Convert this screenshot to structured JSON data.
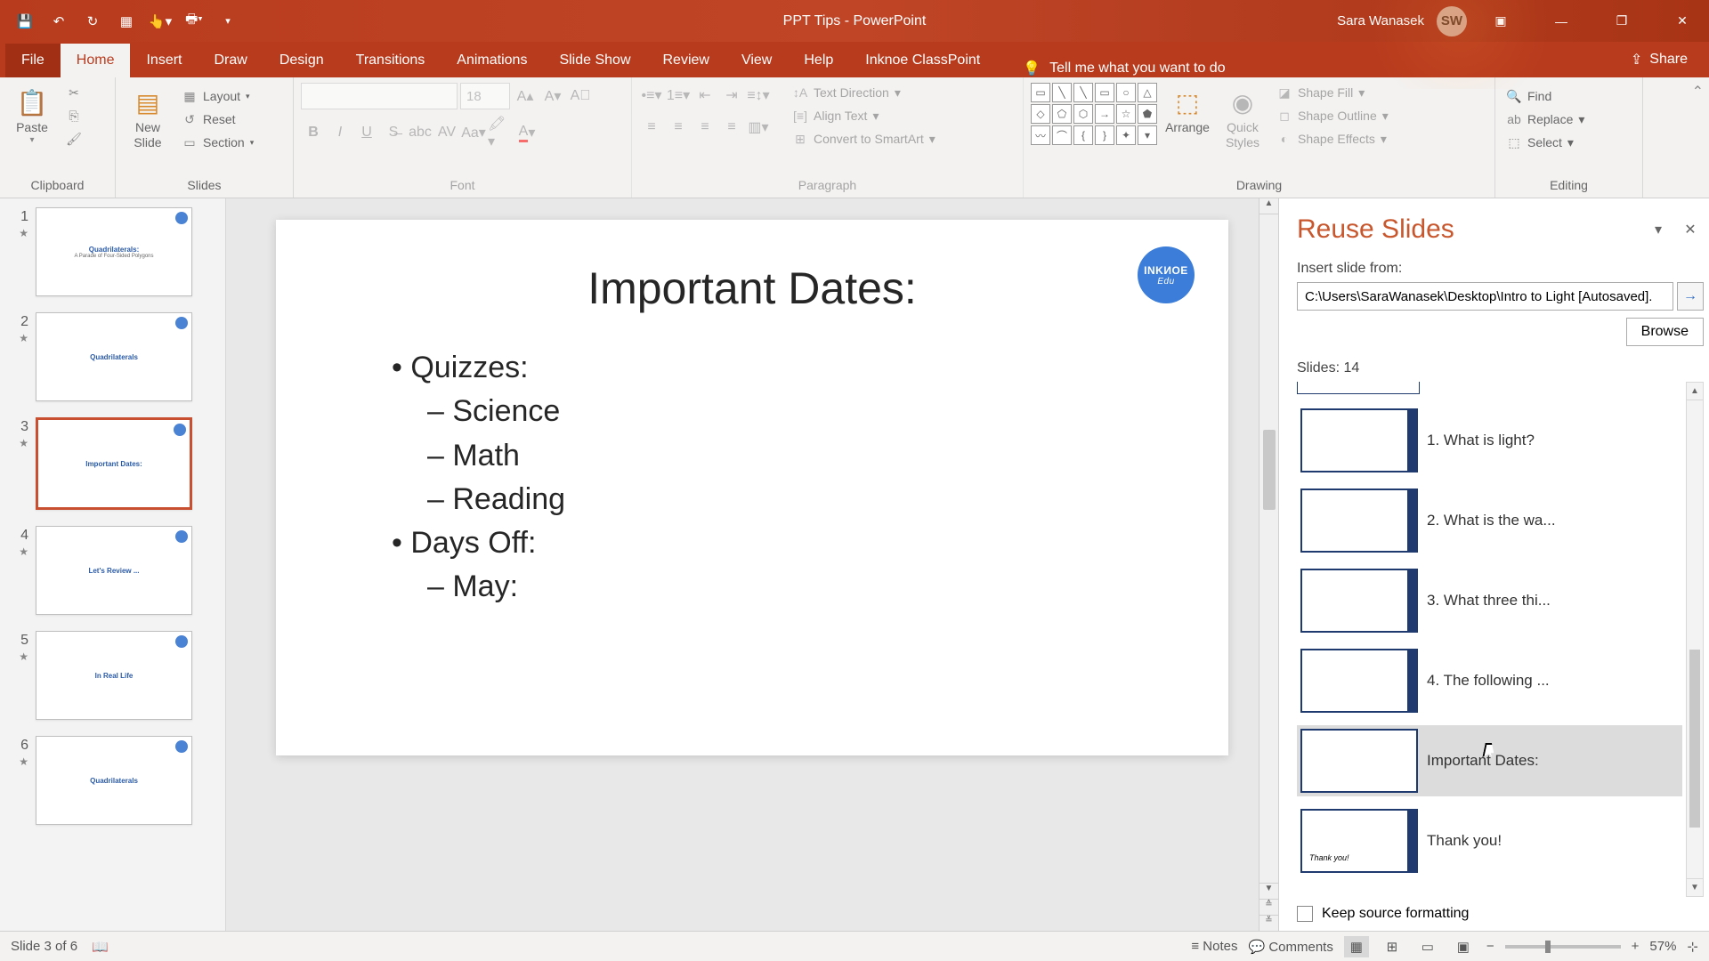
{
  "title": "PPT Tips  -  PowerPoint",
  "user": {
    "name": "Sara Wanasek",
    "initials": "SW"
  },
  "tabs": [
    "File",
    "Home",
    "Insert",
    "Draw",
    "Design",
    "Transitions",
    "Animations",
    "Slide Show",
    "Review",
    "View",
    "Help",
    "Inknoe ClassPoint"
  ],
  "active_tab": "Home",
  "tell_me": "Tell me what you want to do",
  "share": "Share",
  "ribbon": {
    "clipboard": {
      "label": "Clipboard",
      "paste": "Paste"
    },
    "slides": {
      "label": "Slides",
      "new_slide": "New\nSlide",
      "layout": "Layout",
      "reset": "Reset",
      "section": "Section"
    },
    "font": {
      "label": "Font",
      "size": "18"
    },
    "paragraph": {
      "label": "Paragraph",
      "text_direction": "Text Direction",
      "align_text": "Align Text",
      "smartart": "Convert to SmartArt"
    },
    "drawing": {
      "label": "Drawing",
      "arrange": "Arrange",
      "quick_styles": "Quick\nStyles",
      "fill": "Shape Fill",
      "outline": "Shape Outline",
      "effects": "Shape Effects"
    },
    "editing": {
      "label": "Editing",
      "find": "Find",
      "replace": "Replace",
      "select": "Select"
    }
  },
  "thumbs": [
    {
      "n": "1",
      "title": "Quadrilaterals:",
      "sub": "A Parade of Four-Sided Polygons"
    },
    {
      "n": "2",
      "title": "Quadrilaterals",
      "sub": ""
    },
    {
      "n": "3",
      "title": "Important Dates:",
      "sub": ""
    },
    {
      "n": "4",
      "title": "Let's Review ...",
      "sub": ""
    },
    {
      "n": "5",
      "title": "In Real Life",
      "sub": ""
    },
    {
      "n": "6",
      "title": "Quadrilaterals",
      "sub": ""
    }
  ],
  "selected_thumb": 2,
  "slide": {
    "title": "Important Dates:",
    "items": [
      {
        "lvl": 1,
        "text": "Quizzes:"
      },
      {
        "lvl": 2,
        "text": "Science"
      },
      {
        "lvl": 2,
        "text": "Math"
      },
      {
        "lvl": 2,
        "text": "Reading"
      },
      {
        "lvl": 1,
        "text": "Days Off:"
      },
      {
        "lvl": 2,
        "text": "May:"
      }
    ],
    "badge_top": "INKИOE",
    "badge_bot": "Edu"
  },
  "pane": {
    "title": "Reuse Slides",
    "from_label": "Insert slide from:",
    "path": "C:\\Users\\SaraWanasek\\Desktop\\Intro to Light [Autosaved].",
    "browse": "Browse",
    "count": "Slides: 14",
    "items": [
      {
        "label": "1. What is light?"
      },
      {
        "label": "2. What is the wa..."
      },
      {
        "label": "3. What three thi..."
      },
      {
        "label": "4. The following ..."
      },
      {
        "label": "Important Dates:"
      },
      {
        "label": "Thank you!"
      }
    ],
    "hover_index": 4,
    "keep": "Keep source formatting"
  },
  "status": {
    "slide": "Slide 3 of 6",
    "notes": "Notes",
    "comments": "Comments",
    "zoom": "57%"
  }
}
